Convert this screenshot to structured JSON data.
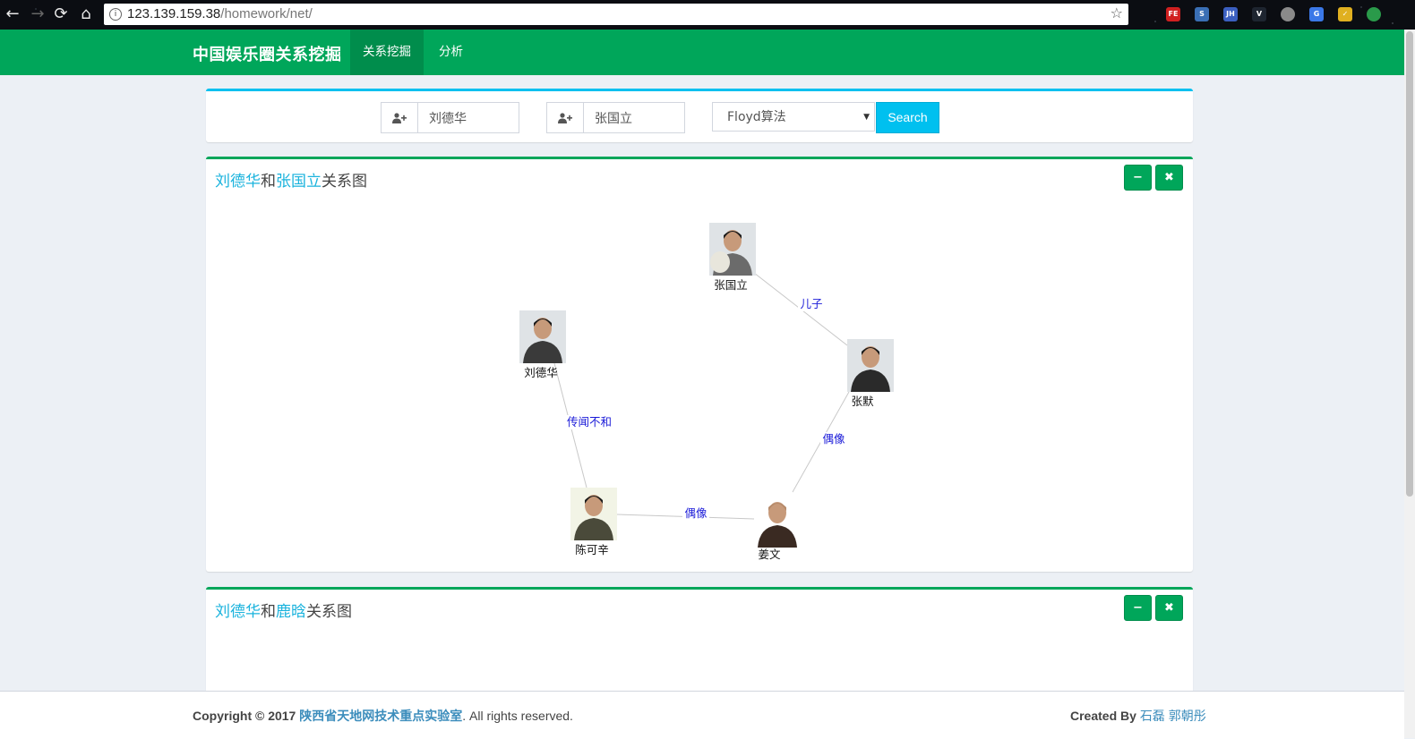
{
  "browser": {
    "url_host": "123.139.159.38",
    "url_path": "/homework/net/",
    "extensions": [
      {
        "name": "fe-extension-icon",
        "label": "FE",
        "color": "#d02020"
      },
      {
        "name": "extension-icon-2",
        "label": "S",
        "color": "#3a6fb5"
      },
      {
        "name": "jh-extension-icon",
        "label": "JH",
        "color": "#3b5fc0"
      },
      {
        "name": "vue-extension-icon",
        "label": "V",
        "color": "#1e2530"
      },
      {
        "name": "extension-icon-5",
        "label": "",
        "color": "#8a8a8a"
      },
      {
        "name": "translate-extension-icon",
        "label": "G",
        "color": "#3b78e7"
      },
      {
        "name": "extension-icon-7",
        "label": "✓",
        "color": "#e0b020"
      },
      {
        "name": "chrome-extension-icon",
        "label": "",
        "color": "#2a9a4a"
      }
    ]
  },
  "navbar": {
    "brand": "中国娱乐圈关系挖掘",
    "items": [
      "关系挖掘",
      "分析"
    ]
  },
  "search": {
    "person1": "刘德华",
    "person2": "张国立",
    "algorithm": "Floyd算法",
    "button": "Search"
  },
  "panel1": {
    "name_a": "刘德华",
    "conj": "和",
    "name_b": "张国立",
    "suffix": "关系图",
    "minimize_label": "−",
    "close_label": "✖"
  },
  "panel2": {
    "name_a": "刘德华",
    "conj": "和",
    "name_b": "鹿晗",
    "suffix": "关系图",
    "minimize_label": "−",
    "close_label": "✖"
  },
  "graph": {
    "nodes": [
      {
        "id": "zgl",
        "label": "张国立",
        "tone": "#6b6b6b"
      },
      {
        "id": "zm",
        "label": "张默",
        "tone": "#2a2a2a"
      },
      {
        "id": "jw",
        "label": "姜文",
        "tone": "#3a2a22"
      },
      {
        "id": "ckx",
        "label": "陈可辛",
        "tone": "#4a4a3a"
      },
      {
        "id": "ldh",
        "label": "刘德华",
        "tone": "#3a3a3a"
      }
    ],
    "edges": [
      {
        "from": "zgl",
        "to": "zm",
        "label": "儿子"
      },
      {
        "from": "zm",
        "to": "jw",
        "label": "偶像"
      },
      {
        "from": "ckx",
        "to": "jw",
        "label": "偶像"
      },
      {
        "from": "ldh",
        "to": "ckx",
        "label": "传闻不和"
      }
    ],
    "label_color": "#1a1ad8"
  },
  "footer": {
    "copyright": "Copyright © 2017",
    "lab": "陕西省天地网技术重点实验室",
    "rights": ". All rights reserved.",
    "created_by": "Created By",
    "authors": "石磊 郭朝彤"
  }
}
